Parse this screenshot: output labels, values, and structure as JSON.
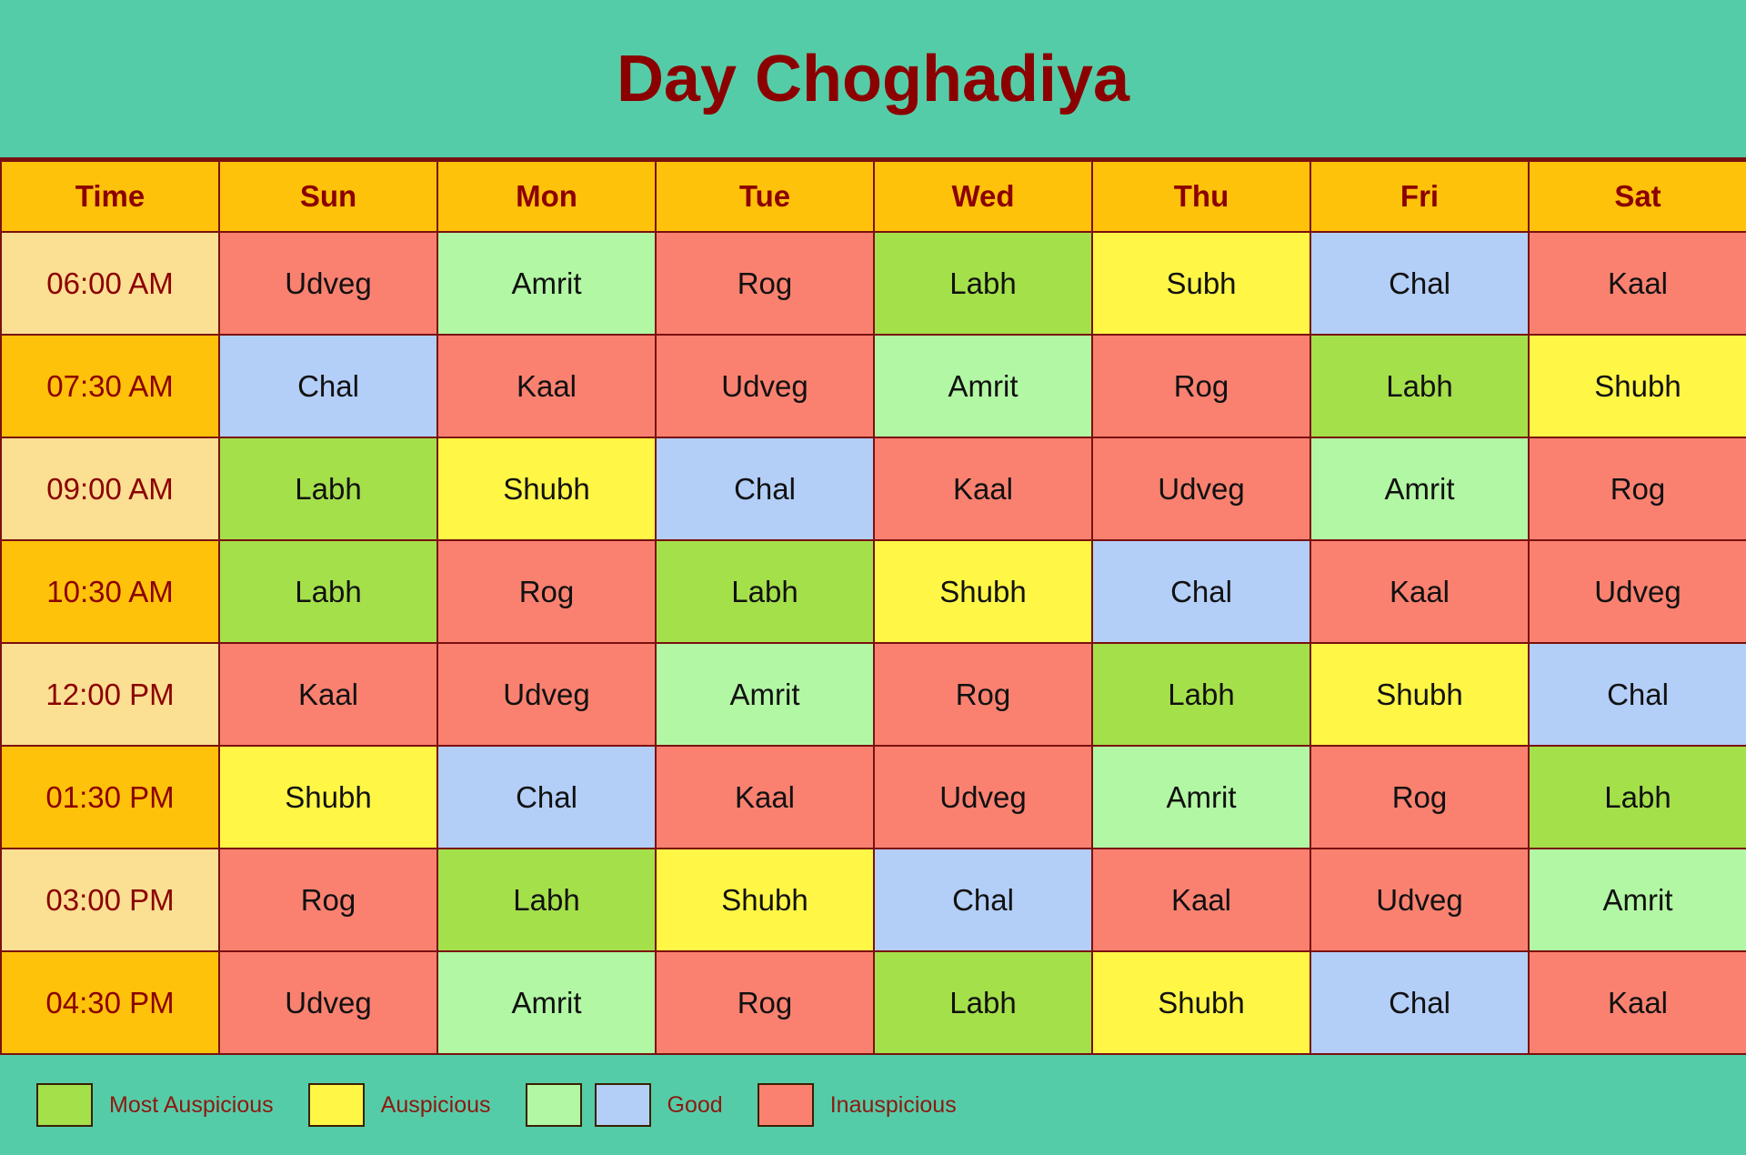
{
  "header": {
    "title": "Day Choghadiya"
  },
  "palette": {
    "page_background": "#55CCA8",
    "border": "#7A1010",
    "title_text": "#8B0000",
    "header_cell_background": "#FFC20A",
    "header_cell_text": "#8B0000",
    "time_cell_light": "#FBDF92",
    "time_cell_dark": "#FFC20A",
    "most_auspicious": "#A4E04A",
    "auspicious": "#FFF646",
    "good_green": "#B2F7A3",
    "good_blue": "#B3CEF7",
    "inauspicious": "#FA8170"
  },
  "table": {
    "columns": [
      "Time",
      "Sun",
      "Mon",
      "Tue",
      "Wed",
      "Thu",
      "Fri",
      "Sat"
    ],
    "rows": [
      {
        "time": "06:00 AM",
        "time_shade": "light",
        "cells": [
          {
            "label": "Udveg",
            "cls": "c-bad"
          },
          {
            "label": "Amrit",
            "cls": "c-amrit"
          },
          {
            "label": "Rog",
            "cls": "c-bad"
          },
          {
            "label": "Labh",
            "cls": "c-labh"
          },
          {
            "label": "Subh",
            "cls": "c-shubh"
          },
          {
            "label": "Chal",
            "cls": "c-chal"
          },
          {
            "label": "Kaal",
            "cls": "c-bad"
          }
        ]
      },
      {
        "time": "07:30 AM",
        "time_shade": "dark",
        "cells": [
          {
            "label": "Chal",
            "cls": "c-chal"
          },
          {
            "label": "Kaal",
            "cls": "c-bad"
          },
          {
            "label": "Udveg",
            "cls": "c-bad"
          },
          {
            "label": "Amrit",
            "cls": "c-amrit"
          },
          {
            "label": "Rog",
            "cls": "c-bad"
          },
          {
            "label": "Labh",
            "cls": "c-labh"
          },
          {
            "label": "Shubh",
            "cls": "c-shubh"
          }
        ]
      },
      {
        "time": "09:00 AM",
        "time_shade": "light",
        "cells": [
          {
            "label": "Labh",
            "cls": "c-labh"
          },
          {
            "label": "Shubh",
            "cls": "c-shubh"
          },
          {
            "label": "Chal",
            "cls": "c-chal"
          },
          {
            "label": "Kaal",
            "cls": "c-bad"
          },
          {
            "label": "Udveg",
            "cls": "c-bad"
          },
          {
            "label": "Amrit",
            "cls": "c-amrit"
          },
          {
            "label": "Rog",
            "cls": "c-bad"
          }
        ]
      },
      {
        "time": "10:30 AM",
        "time_shade": "dark",
        "cells": [
          {
            "label": "Labh",
            "cls": "c-labh"
          },
          {
            "label": "Rog",
            "cls": "c-bad"
          },
          {
            "label": "Labh",
            "cls": "c-labh"
          },
          {
            "label": "Shubh",
            "cls": "c-shubh"
          },
          {
            "label": "Chal",
            "cls": "c-chal"
          },
          {
            "label": "Kaal",
            "cls": "c-bad"
          },
          {
            "label": "Udveg",
            "cls": "c-bad"
          }
        ]
      },
      {
        "time": "12:00 PM",
        "time_shade": "light",
        "cells": [
          {
            "label": "Kaal",
            "cls": "c-bad"
          },
          {
            "label": "Udveg",
            "cls": "c-bad"
          },
          {
            "label": "Amrit",
            "cls": "c-amrit"
          },
          {
            "label": "Rog",
            "cls": "c-bad"
          },
          {
            "label": "Labh",
            "cls": "c-labh"
          },
          {
            "label": "Shubh",
            "cls": "c-shubh"
          },
          {
            "label": "Chal",
            "cls": "c-chal"
          }
        ]
      },
      {
        "time": "01:30 PM",
        "time_shade": "dark",
        "cells": [
          {
            "label": "Shubh",
            "cls": "c-shubh"
          },
          {
            "label": "Chal",
            "cls": "c-chal"
          },
          {
            "label": "Kaal",
            "cls": "c-bad"
          },
          {
            "label": "Udveg",
            "cls": "c-bad"
          },
          {
            "label": "Amrit",
            "cls": "c-amrit"
          },
          {
            "label": "Rog",
            "cls": "c-bad"
          },
          {
            "label": "Labh",
            "cls": "c-labh"
          }
        ]
      },
      {
        "time": "03:00 PM",
        "time_shade": "light",
        "cells": [
          {
            "label": "Rog",
            "cls": "c-bad"
          },
          {
            "label": "Labh",
            "cls": "c-labh"
          },
          {
            "label": "Shubh",
            "cls": "c-shubh"
          },
          {
            "label": "Chal",
            "cls": "c-chal"
          },
          {
            "label": "Kaal",
            "cls": "c-bad"
          },
          {
            "label": "Udveg",
            "cls": "c-bad"
          },
          {
            "label": "Amrit",
            "cls": "c-amrit"
          }
        ]
      },
      {
        "time": "04:30 PM",
        "time_shade": "dark",
        "cells": [
          {
            "label": "Udveg",
            "cls": "c-bad"
          },
          {
            "label": "Amrit",
            "cls": "c-amrit"
          },
          {
            "label": "Rog",
            "cls": "c-bad"
          },
          {
            "label": "Labh",
            "cls": "c-labh"
          },
          {
            "label": "Shubh",
            "cls": "c-shubh"
          },
          {
            "label": "Chal",
            "cls": "c-chal"
          },
          {
            "label": "Kaal",
            "cls": "c-bad"
          }
        ]
      }
    ]
  },
  "legend": {
    "items": [
      {
        "label": "Most Auspicious",
        "swatches": [
          "#A4E04A"
        ]
      },
      {
        "label": "Auspicious",
        "swatches": [
          "#FFF646"
        ]
      },
      {
        "label": "Good",
        "swatches": [
          "#B2F7A3",
          "#B3CEF7"
        ]
      },
      {
        "label": "Inauspicious",
        "swatches": [
          "#FA8170"
        ]
      }
    ]
  }
}
